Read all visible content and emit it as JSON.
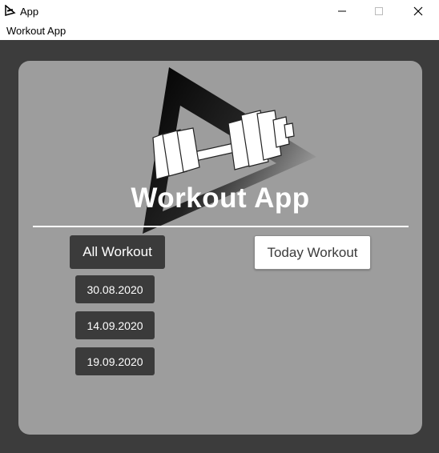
{
  "window": {
    "title": "App",
    "icon": "app-logo-icon",
    "controls": [
      "minimize-icon",
      "maximize-icon",
      "close-icon"
    ]
  },
  "menubar": {
    "title": "Workout App"
  },
  "main": {
    "logo": "triangle-dumbbell-logo",
    "title": "Workout App",
    "all_workout_label": "All Workout",
    "today_workout_label": "Today Workout",
    "dates": [
      "30.08.2020",
      "14.09.2020",
      "19.09.2020"
    ]
  },
  "colors": {
    "background": "#3c3c3c",
    "panel": "#9d9d9d",
    "dark_button": "#3b3b3b",
    "light_button": "#ffffff"
  }
}
